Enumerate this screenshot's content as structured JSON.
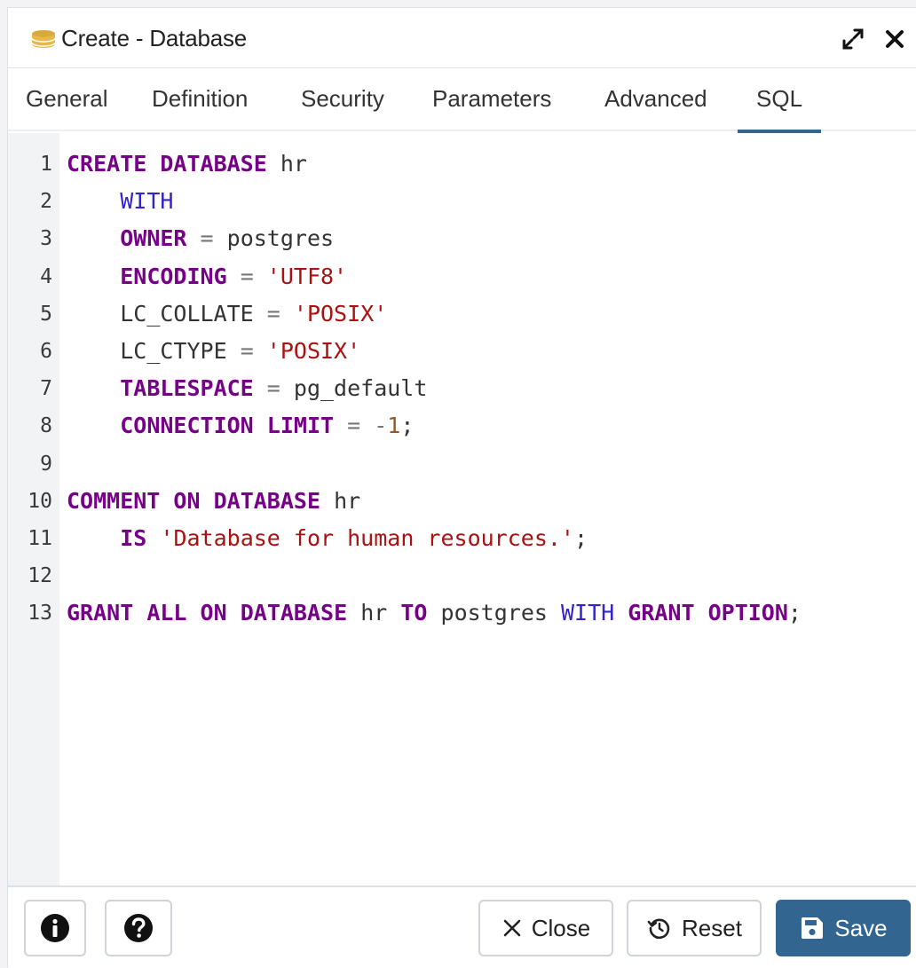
{
  "dialog": {
    "title": "Create - Database"
  },
  "tabs": [
    {
      "label": "General"
    },
    {
      "label": "Definition"
    },
    {
      "label": "Security"
    },
    {
      "label": "Parameters"
    },
    {
      "label": "Advanced"
    },
    {
      "label": "SQL",
      "active": true
    }
  ],
  "editor": {
    "line_numbers": [
      "1",
      "2",
      "3",
      "4",
      "5",
      "6",
      "7",
      "8",
      "9",
      "10",
      "11",
      "12",
      "13"
    ],
    "lines": [
      {
        "indent": "",
        "tokens": [
          [
            "kw",
            "CREATE"
          ],
          [
            "plain",
            " "
          ],
          [
            "kw",
            "DATABASE"
          ],
          [
            "plain",
            " hr"
          ]
        ]
      },
      {
        "indent": "    ",
        "tokens": [
          [
            "kw2",
            "WITH"
          ]
        ]
      },
      {
        "indent": "    ",
        "tokens": [
          [
            "kw",
            "OWNER"
          ],
          [
            "op",
            " = "
          ],
          [
            "plain",
            "postgres"
          ]
        ]
      },
      {
        "indent": "    ",
        "tokens": [
          [
            "kw",
            "ENCODING"
          ],
          [
            "op",
            " = "
          ],
          [
            "str",
            "'UTF8'"
          ]
        ]
      },
      {
        "indent": "    ",
        "tokens": [
          [
            "plain",
            "LC_COLLATE"
          ],
          [
            "op",
            " = "
          ],
          [
            "str",
            "'POSIX'"
          ]
        ]
      },
      {
        "indent": "    ",
        "tokens": [
          [
            "plain",
            "LC_CTYPE"
          ],
          [
            "op",
            " = "
          ],
          [
            "str",
            "'POSIX'"
          ]
        ]
      },
      {
        "indent": "    ",
        "tokens": [
          [
            "kw",
            "TABLESPACE"
          ],
          [
            "op",
            " = "
          ],
          [
            "plain",
            "pg_default"
          ]
        ]
      },
      {
        "indent": "    ",
        "tokens": [
          [
            "kw",
            "CONNECTION"
          ],
          [
            "plain",
            " "
          ],
          [
            "kw",
            "LIMIT"
          ],
          [
            "op",
            " = "
          ],
          [
            "op",
            "-"
          ],
          [
            "num",
            "1"
          ],
          [
            "plain",
            ";"
          ]
        ]
      },
      {
        "indent": "",
        "tokens": []
      },
      {
        "indent": "",
        "tokens": [
          [
            "kw",
            "COMMENT"
          ],
          [
            "plain",
            " "
          ],
          [
            "kw",
            "ON"
          ],
          [
            "plain",
            " "
          ],
          [
            "kw",
            "DATABASE"
          ],
          [
            "plain",
            " hr"
          ]
        ]
      },
      {
        "indent": "    ",
        "tokens": [
          [
            "kw",
            "IS"
          ],
          [
            "plain",
            " "
          ],
          [
            "str",
            "'Database for human resources.'"
          ],
          [
            "plain",
            ";"
          ]
        ]
      },
      {
        "indent": "",
        "tokens": []
      },
      {
        "indent": "",
        "tokens": [
          [
            "kw",
            "GRANT"
          ],
          [
            "plain",
            " "
          ],
          [
            "kw",
            "ALL"
          ],
          [
            "plain",
            " "
          ],
          [
            "kw",
            "ON"
          ],
          [
            "plain",
            " "
          ],
          [
            "kw",
            "DATABASE"
          ],
          [
            "plain",
            " hr "
          ],
          [
            "kw",
            "TO"
          ],
          [
            "plain",
            " postgres "
          ],
          [
            "kw2",
            "WITH"
          ],
          [
            "plain",
            " "
          ],
          [
            "kw",
            "GRANT"
          ],
          [
            "plain",
            " "
          ],
          [
            "kw",
            "OPTION"
          ],
          [
            "plain",
            ";"
          ]
        ]
      }
    ]
  },
  "footer": {
    "close_label": "Close",
    "reset_label": "Reset",
    "save_label": "Save"
  },
  "icons": {
    "title": "database-icon",
    "expand": "expand-icon",
    "close": "close-icon",
    "info": "info-icon",
    "help": "help-icon",
    "reset": "reset-icon",
    "save": "save-icon"
  },
  "colors": {
    "accent": "#326690",
    "keyword": "#770088",
    "keyword_alt": "#3323c8",
    "string": "#aa1111",
    "number": "#a0521f"
  }
}
